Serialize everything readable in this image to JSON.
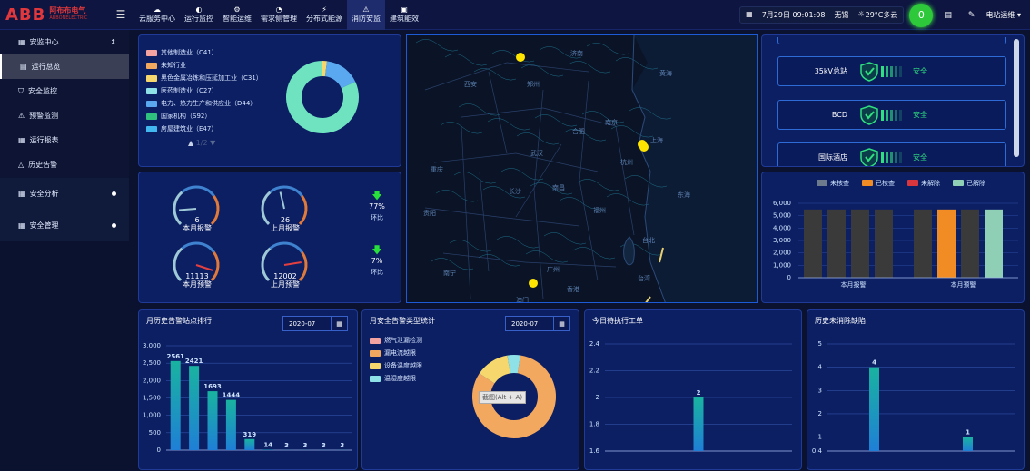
{
  "app": {
    "logo_mark": "ABB",
    "logo_cn": "阿布布电气",
    "logo_en": "ABBONELECTRIC"
  },
  "nav": [
    {
      "label": "云服务中心",
      "icon": "cloud-icon"
    },
    {
      "label": "运行监控",
      "icon": "monitor-icon"
    },
    {
      "label": "智能运维",
      "icon": "gear-icon"
    },
    {
      "label": "需求侧管理",
      "icon": "chart-icon"
    },
    {
      "label": "分布式能源",
      "icon": "energy-icon"
    },
    {
      "label": "消防安监",
      "icon": "fire-icon"
    },
    {
      "label": "建筑能效",
      "icon": "building-icon"
    }
  ],
  "topright": {
    "date": "7月29日 09:01:08",
    "city": "无锡",
    "weather": "29°C多云",
    "notif_count": "0",
    "user": "电站运维"
  },
  "sidebar": {
    "group1": "安监中心",
    "items": [
      "运行总览",
      "安全监控",
      "预警监测",
      "运行报表",
      "历史告警"
    ],
    "group2": "安全分析",
    "group3": "安全管理"
  },
  "industry_legend": [
    {
      "label": "其他制造业（C41）",
      "color": "#f4a3a0"
    },
    {
      "label": "未知行业",
      "color": "#f3a860"
    },
    {
      "label": "黑色金属冶炼和压延加工业（C31）",
      "color": "#f5d76e"
    },
    {
      "label": "医药制造业（C27）",
      "color": "#8fe1e8"
    },
    {
      "label": "电力、热力生产和供应业（D44）",
      "color": "#5aa9f0"
    },
    {
      "label": "国家机构（S92）",
      "color": "#2ec27e"
    },
    {
      "label": "房屋建筑业（E47）",
      "color": "#42b8f0"
    }
  ],
  "industry_page": "1/2",
  "industry_donut": [
    {
      "value": 2,
      "color": "#f5d76e"
    },
    {
      "value": 16,
      "color": "#5aa9f0"
    },
    {
      "value": 82,
      "color": "#6fe3c0"
    }
  ],
  "gauges": [
    {
      "value": "6",
      "label": "本月报警",
      "level": 0.15
    },
    {
      "value": "26",
      "label": "上月报警",
      "level": 0.45
    },
    {
      "value": "11113",
      "label": "本月预警",
      "level": 0.9
    },
    {
      "value": "12002",
      "label": "上月预警",
      "level": 0.8
    }
  ],
  "trends": [
    {
      "pct": "77%",
      "label": "环比"
    },
    {
      "pct": "7%",
      "label": "环比"
    }
  ],
  "map": {
    "cities": [
      "西安",
      "郑州",
      "济南",
      "黄海",
      "合肥",
      "南京",
      "上海",
      "杭州",
      "武汉",
      "重庆",
      "长沙",
      "南昌",
      "东海",
      "贵阳",
      "福州",
      "台北",
      "南宁",
      "广州",
      "香港",
      "澳门",
      "台湾"
    ],
    "markers": 4
  },
  "stations": [
    {
      "name": "35kV总站",
      "status": "安全"
    },
    {
      "name": "BCD",
      "status": "安全"
    },
    {
      "name": "国际酒店",
      "status": "安全"
    }
  ],
  "alarm_status_chart": {
    "type": "bar",
    "legend": [
      "未核查",
      "已核查",
      "未解除",
      "已解除"
    ],
    "colors": [
      "#6c7a8c",
      "#f08c23",
      "#d9363e",
      "#8ecfb6"
    ],
    "categories": [
      "本月报警",
      "本月预警"
    ],
    "series_values": [
      [
        5500,
        5500,
        5500,
        5500
      ],
      [
        5500,
        5500,
        5500,
        5500
      ]
    ],
    "bar_colors": [
      [
        "#3a3a3a",
        "#3a3a3a",
        "#3a3a3a",
        "#3a3a3a"
      ],
      [
        "#3a3a3a",
        "#f08c23",
        "#3a3a3a",
        "#8ecfb6"
      ]
    ],
    "yticks": [
      "6,000",
      "5,000",
      "4,000",
      "3,000",
      "2,000",
      "1,000",
      "0"
    ],
    "ylim": [
      0,
      6000
    ]
  },
  "history_rank": {
    "title": "月历史告警站点排行",
    "date": "2020-07",
    "chart_data": {
      "type": "bar",
      "values": [
        2561,
        2421,
        1693,
        1444,
        319,
        14,
        3,
        3,
        3,
        3
      ],
      "labels": [
        "2561",
        "2421",
        "1693",
        "1444",
        "319",
        "14",
        "3",
        "3",
        "3",
        "3"
      ],
      "yticks": [
        "3,000",
        "2,500",
        "2,000",
        "1,500",
        "1,000",
        "500",
        "0"
      ],
      "ylim": [
        0,
        3000
      ]
    }
  },
  "alarm_type": {
    "title": "月安全告警类型统计",
    "date": "2020-07",
    "legend": [
      {
        "label": "燃气泄漏检测",
        "color": "#f4a3a0"
      },
      {
        "label": "漏电流越限",
        "color": "#f3a860"
      },
      {
        "label": "设备温度越限",
        "color": "#f5d76e"
      },
      {
        "label": "温湿度越限",
        "color": "#8fe1e8"
      }
    ],
    "donut": [
      {
        "value": 82,
        "color": "#f3a860"
      },
      {
        "value": 13,
        "color": "#f5d76e"
      },
      {
        "value": 5,
        "color": "#8fe1e8"
      }
    ],
    "tooltip": "截图(Alt + A)"
  },
  "work_orders": {
    "title": "今日待执行工单",
    "chart_data": {
      "type": "bar",
      "values": [
        2
      ],
      "labels": [
        "2"
      ],
      "yticks": [
        "2.4",
        "2.2",
        "2",
        "1.8",
        "1.6"
      ],
      "ylim": [
        1.6,
        2.4
      ]
    }
  },
  "defects": {
    "title": "历史未消除缺陷",
    "chart_data": {
      "type": "bar",
      "values": [
        4,
        1
      ],
      "labels": [
        "4",
        "1"
      ],
      "yticks": [
        "5",
        "4",
        "3",
        "2",
        "1",
        "0.4"
      ],
      "ylim": [
        0.4,
        5
      ]
    }
  }
}
